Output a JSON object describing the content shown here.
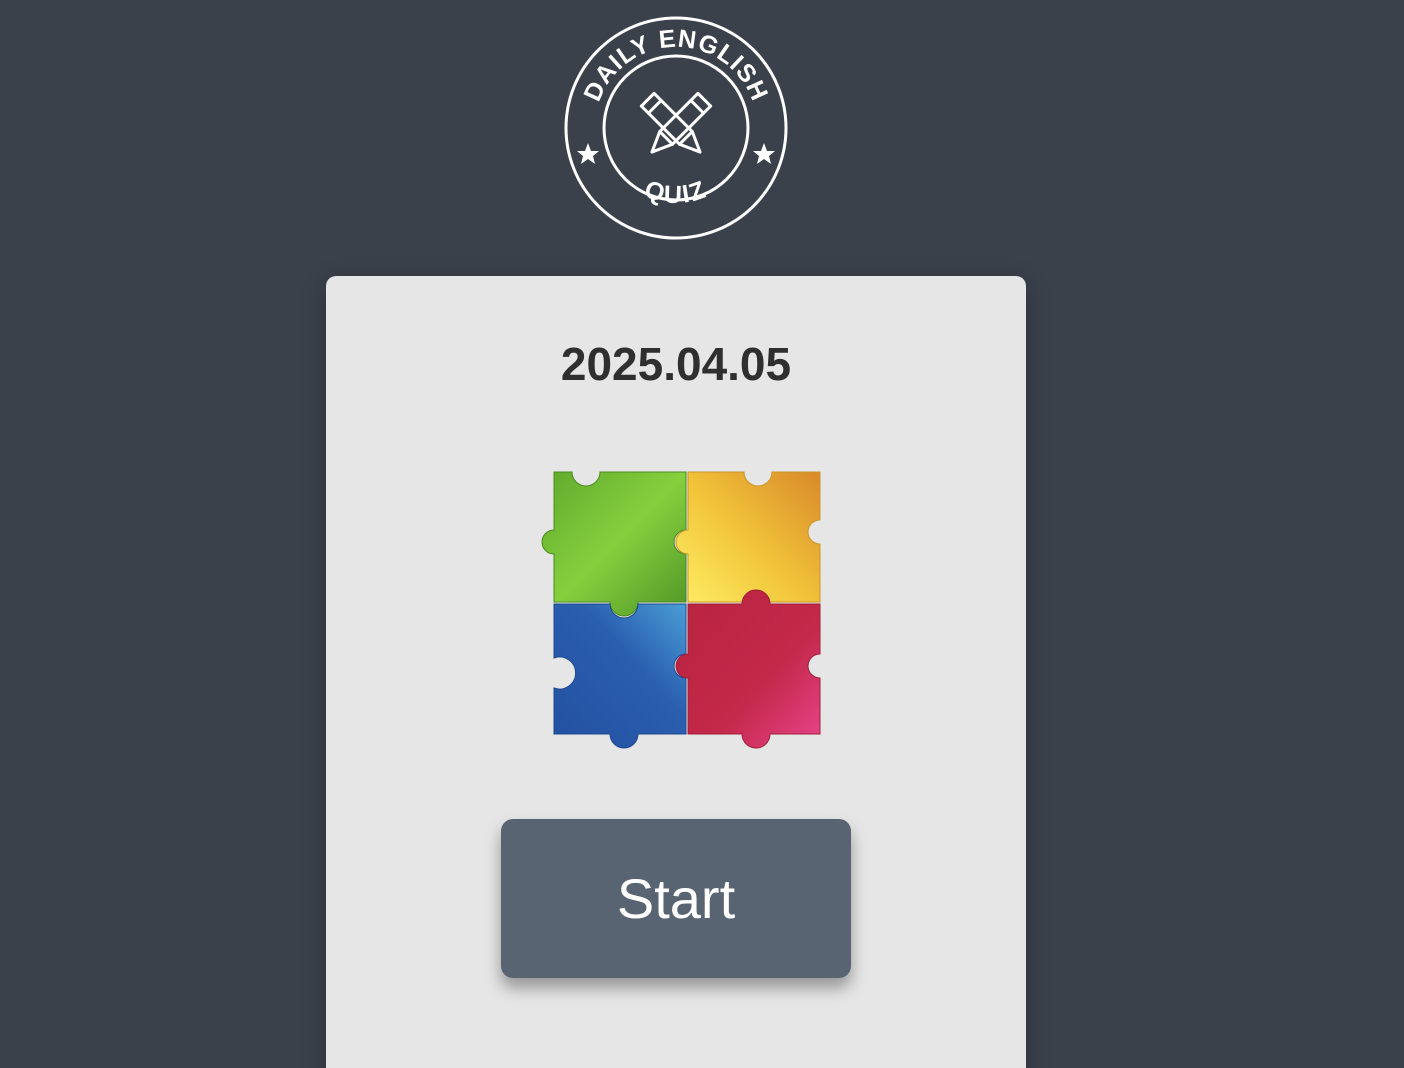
{
  "logo": {
    "top_text": "DAILY ENGLISH",
    "bottom_text": "QUIZ",
    "icon": "crossed-pencils-icon",
    "color": "#ffffff"
  },
  "card": {
    "date": "2025.04.05",
    "illustration": "puzzle-pieces-icon",
    "start_label": "Start"
  },
  "colors": {
    "background": "#3a414b",
    "card": "#e6e6e6",
    "button": "#586472",
    "puzzle_green": "#6cbf35",
    "puzzle_yellow": "#f2c53a",
    "puzzle_blue": "#2a5eaf",
    "puzzle_red": "#c4284a"
  }
}
